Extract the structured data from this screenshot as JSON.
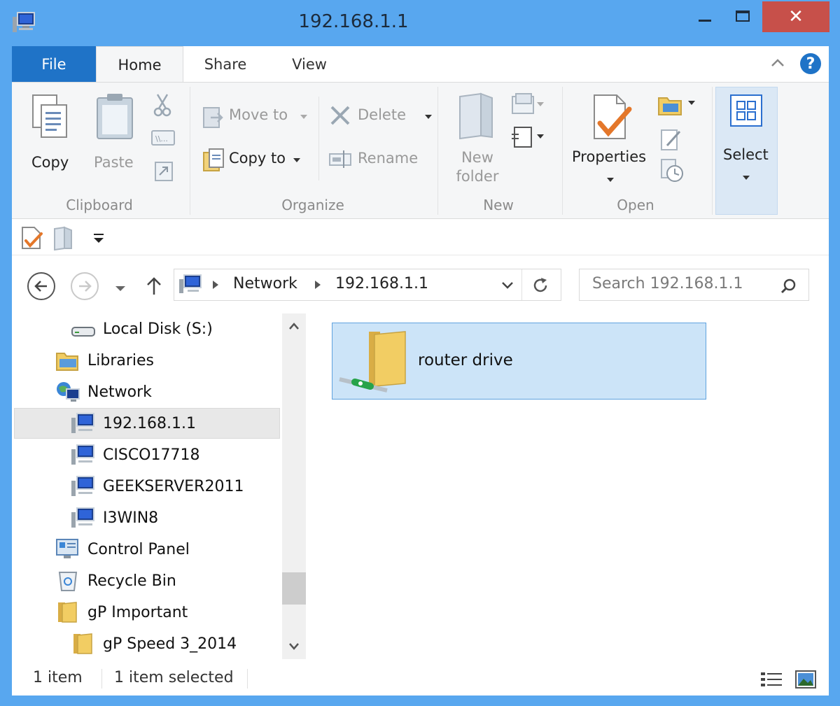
{
  "window": {
    "title": "192.168.1.1",
    "close_glyph": "✕"
  },
  "tabs": {
    "file": "File",
    "home": "Home",
    "share": "Share",
    "view": "View",
    "help": "?"
  },
  "ribbon": {
    "clipboard": {
      "copy": "Copy",
      "paste": "Paste",
      "group_label": "Clipboard"
    },
    "organize": {
      "move_to": "Move to",
      "copy_to": "Copy to",
      "delete": "Delete",
      "rename": "Rename",
      "group_label": "Organize"
    },
    "new": {
      "new_folder_line1": "New",
      "new_folder_line2": "folder",
      "group_label": "New"
    },
    "open": {
      "properties": "Properties",
      "group_label": "Open"
    },
    "select": {
      "select": "Select"
    }
  },
  "address": {
    "segments": [
      "Network",
      "192.168.1.1"
    ],
    "search_placeholder": "Search 192.168.1.1"
  },
  "nav_tree": [
    {
      "label": "Local Disk (S:)",
      "icon": "drive-icon"
    },
    {
      "label": "Libraries",
      "icon": "libraries-icon"
    },
    {
      "label": "Network",
      "icon": "network-icon"
    },
    {
      "label": "192.168.1.1",
      "icon": "computer-icon",
      "selected": true
    },
    {
      "label": "CISCO17718",
      "icon": "computer-icon"
    },
    {
      "label": "GEEKSERVER2011",
      "icon": "computer-icon"
    },
    {
      "label": "I3WIN8",
      "icon": "computer-icon"
    },
    {
      "label": "Control Panel",
      "icon": "control-panel-icon"
    },
    {
      "label": "Recycle Bin",
      "icon": "recycle-bin-icon"
    },
    {
      "label": "gP Important",
      "icon": "folder-icon"
    },
    {
      "label": "gP Speed 3_2014",
      "icon": "folder-icon"
    }
  ],
  "content": {
    "items": [
      {
        "label": "router drive",
        "icon": "network-share-folder-icon",
        "selected": true
      }
    ]
  },
  "status": {
    "count": "1 item",
    "selected": "1 item selected"
  },
  "colors": {
    "frame": "#58a7ef",
    "file_tab": "#1f73c7",
    "close": "#c7504a",
    "selection": "#cce4f8"
  }
}
